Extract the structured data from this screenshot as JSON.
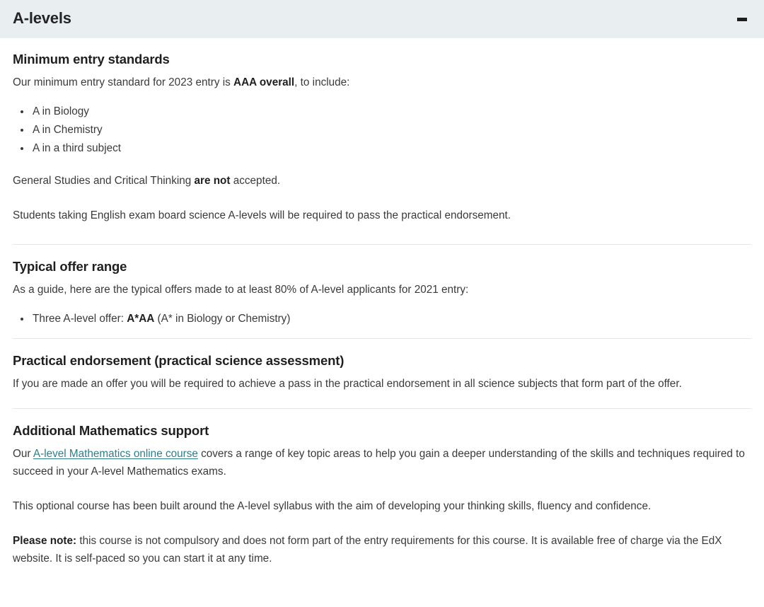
{
  "panel": {
    "title": "A-levels",
    "toggle_icon": "minus-icon",
    "expanded": true,
    "header_bg": "#e9eef0",
    "link_color": "#2b7f8c",
    "divider_color": "#e6e6e6"
  },
  "sections": [
    {
      "heading": "Minimum entry standards",
      "intro_before": "Our minimum entry standard for 2023 entry is ",
      "intro_bold": "AAA overall",
      "intro_after": ", to include:",
      "bullets": [
        "A in Biology",
        "A in Chemistry",
        "A in a third subject"
      ],
      "para2_before": "General Studies and Critical Thinking ",
      "para2_bold": "are not",
      "para2_after": " accepted.",
      "para3": "Students taking English exam board science A-levels will be required to pass the practical endorsement."
    },
    {
      "heading": "Typical offer range",
      "intro": "As a guide, here are the typical offers made to at least 80% of A-level applicants for 2021 entry:",
      "bullet_before": "Three A-level offer: ",
      "bullet_bold": "A*AA",
      "bullet_after": " (A* in Biology or Chemistry)"
    },
    {
      "heading": "Practical endorsement (practical science assessment)",
      "para": "If you are made an offer you will be required to achieve a pass in the practical endorsement in all science subjects that form part of the offer."
    },
    {
      "heading": "Additional Mathematics support",
      "para1_before": "Our ",
      "link_text": "A-level Mathematics online course",
      "para1_after": " covers a range of key topic areas to help you gain a deeper understanding of the skills and techniques required to succeed in your A-level Mathematics exams.",
      "para2": "This optional course has been built around the A-level syllabus with the aim of developing your thinking skills, fluency and confidence.",
      "para3_bold": "Please note:",
      "para3_after": " this course is not compulsory and does not form part of the entry requirements for this course. It is available free of charge via the EdX website. It is self-paced so you can start it at any time."
    }
  ]
}
